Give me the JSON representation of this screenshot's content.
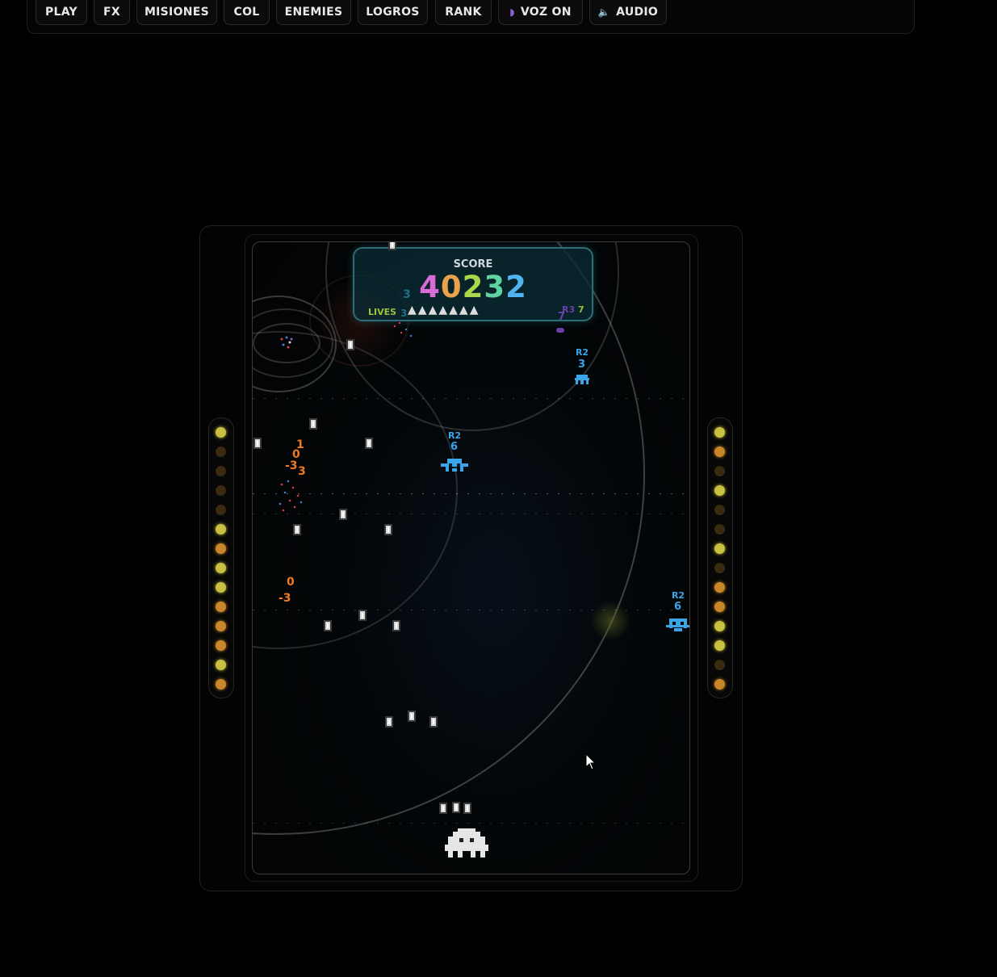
{
  "toolbar": {
    "buttons": [
      {
        "label": "PLAY"
      },
      {
        "label": "FX"
      },
      {
        "label": "MISIONES"
      },
      {
        "label": "COL"
      },
      {
        "label": "ENEMIES"
      },
      {
        "label": "LOGROS"
      },
      {
        "label": "RANK"
      },
      {
        "label": "VOZ ON",
        "icon": "speaking-head-icon"
      },
      {
        "label": "AUDIO",
        "icon": "speaker-icon"
      }
    ]
  },
  "hud": {
    "score_label": "SCORE",
    "score_digits": [
      "4",
      "0",
      "2",
      "3",
      "2"
    ],
    "score_colors": [
      "#d96bd6",
      "#e8a24c",
      "#a8d84a",
      "#5fd3a0",
      "#4fb4f0"
    ],
    "lives_label": "LIVES",
    "lives_count": 7,
    "round_label": "R3",
    "round_value": "7"
  },
  "enemies": [
    {
      "round": "R2",
      "value": "3",
      "color": "#3aa6e8"
    },
    {
      "round": "R2",
      "value": "6",
      "color": "#3aa6e8"
    },
    {
      "round": "R2",
      "value": "6",
      "color": "#3aa6e8"
    }
  ],
  "floating_numbers": {
    "group_a": [
      "1",
      "0",
      "-3",
      "3"
    ],
    "group_b": [
      "0",
      "-3"
    ],
    "faded_a": "3",
    "faded_b": "3",
    "faded_c": "7"
  },
  "leds": {
    "left": [
      "on-yellow",
      "off",
      "off",
      "off",
      "off",
      "on-yellow",
      "on-orange",
      "on-yellow",
      "on-yellow",
      "on-orange",
      "on-orange",
      "on-orange",
      "on-yellow",
      "on-orange"
    ],
    "right": [
      "on-yellow",
      "on-orange",
      "off",
      "on-yellow",
      "off",
      "off",
      "on-yellow",
      "off",
      "on-orange",
      "on-orange",
      "on-yellow",
      "on-yellow",
      "off",
      "on-orange"
    ]
  },
  "colors": {
    "led_yellow": "#c8c040",
    "led_orange": "#c8862a",
    "led_off": "#3a2a10",
    "enemy_blue": "#3aa6e8",
    "num_orange": "#f07a22"
  }
}
